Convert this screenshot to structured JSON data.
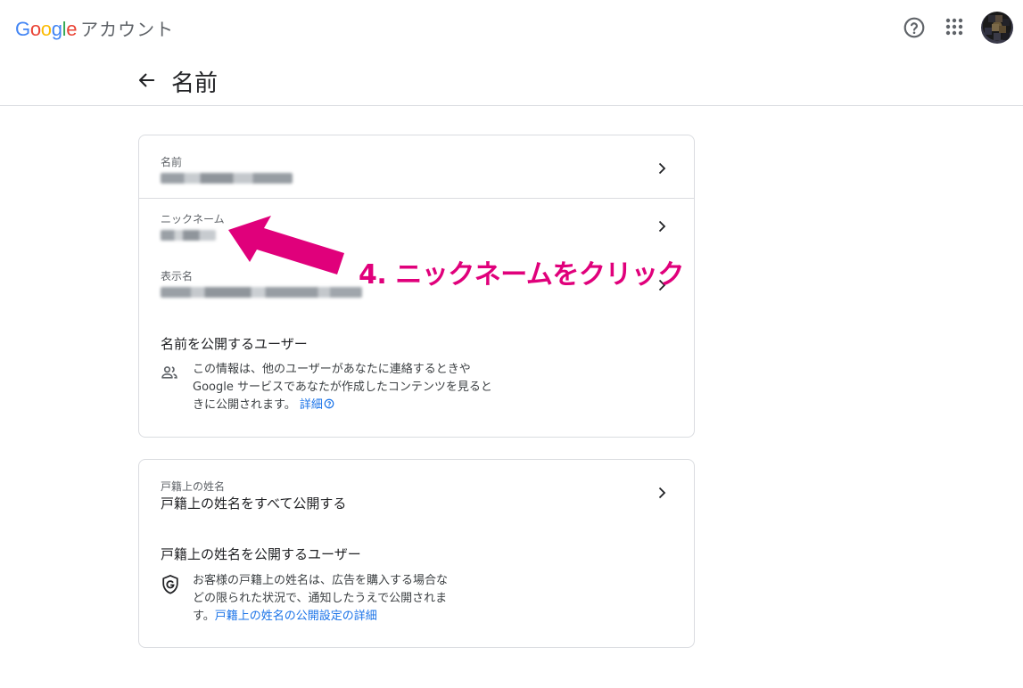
{
  "app": {
    "logo": {
      "letters": [
        "G",
        "o",
        "o",
        "g",
        "l",
        "e"
      ],
      "colors": [
        "#4285F4",
        "#EA4335",
        "#FBBC05",
        "#4285F4",
        "#34A853",
        "#EA4335"
      ]
    },
    "product": "アカウント"
  },
  "topbar": {
    "help_icon": "help-circle-icon",
    "apps_icon": "apps-grid-icon"
  },
  "page": {
    "title": "名前"
  },
  "card1": {
    "rows": [
      {
        "label": "名前"
      },
      {
        "label": "ニックネーム"
      },
      {
        "label": "表示名"
      }
    ],
    "visibility": {
      "title": "名前を公開するユーザー",
      "lines": [
        "この情報は、他のユーザーがあなたに連絡するときや",
        "Google サービスであなたが作成したコンテンツを見ると",
        "きに公開されます。"
      ],
      "link": "詳細"
    }
  },
  "card2": {
    "row": {
      "label": "戸籍上の姓名",
      "value": "戸籍上の姓名をすべて公開する"
    },
    "visibility": {
      "title": "戸籍上の姓名を公開するユーザー",
      "lines": [
        "お客様の戸籍上の姓名は、広告を購入する場合な",
        "どの限られた状況で、通知したうえで公開されま",
        "す。"
      ],
      "link": "戸籍上の姓名の公開設定の詳細"
    }
  },
  "annotation": {
    "text": "4. ニックネームをクリック",
    "color": "#e0007b"
  }
}
